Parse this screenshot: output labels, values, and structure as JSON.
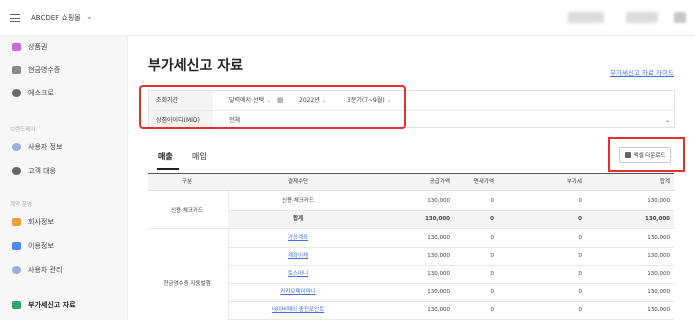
{
  "topbar": {
    "shop_name": "ABCDEF 쇼핑몰"
  },
  "sidebar": {
    "items": [
      {
        "label": "상품권",
        "icon": "gift-card-icon",
        "color": "#c96bd8"
      },
      {
        "label": "현금영수증",
        "icon": "receipt-icon",
        "color": "#8a8a8a"
      },
      {
        "label": "에스크로",
        "icon": "escrow-icon",
        "color": "#6a6a6a"
      },
      {
        "label": "사용자 정보",
        "icon": "user-info-icon",
        "color": "#9ab0d8"
      },
      {
        "label": "고객 대응",
        "icon": "customer-support-icon",
        "color": "#666666"
      },
      {
        "label": "회사정보",
        "icon": "company-icon",
        "color": "#f0a03a"
      },
      {
        "label": "이용정보",
        "icon": "usage-icon",
        "color": "#4a8cf0"
      },
      {
        "label": "사용자 관리",
        "icon": "user-manage-icon",
        "color": "#9ab0d8"
      },
      {
        "label": "부가세신고 자료",
        "icon": "vat-report-icon",
        "color": "#2ea86a"
      }
    ],
    "sections": [
      "브랜드페이",
      "계약·운영"
    ]
  },
  "main": {
    "title": "부가세신고 자료",
    "guide_link": "부가세신고 자료 가이드"
  },
  "filter": {
    "period_label": "조회기간",
    "period_select": "달력에서 선택",
    "year": "2022년",
    "quarter": "3분기(7~9월)",
    "mid_label": "상점아이디(MID)",
    "mid_value": "전체"
  },
  "tabs": [
    {
      "label": "매출",
      "active": true
    },
    {
      "label": "매입",
      "active": false
    }
  ],
  "excel_button": "엑셀 다운로드",
  "table": {
    "headers": [
      "구분",
      "결제수단",
      "공급가액",
      "면세가액",
      "부가세",
      "합계"
    ],
    "group1": "신용·체크카드",
    "group2": "현금영수증 자동발행",
    "rows": [
      {
        "method": "신용·체크카드",
        "supply": "130,000",
        "taxfree": "0",
        "vat": "0",
        "total": "130,000",
        "link": false,
        "bold": false
      },
      {
        "method": "합계",
        "supply": "130,000",
        "taxfree": "0",
        "vat": "0",
        "total": "130,000",
        "link": false,
        "bold": true
      },
      {
        "method": "가상계좌",
        "supply": "130,000",
        "taxfree": "0",
        "vat": "0",
        "total": "130,000",
        "link": true,
        "bold": false
      },
      {
        "method": "계좌이체",
        "supply": "130,000",
        "taxfree": "0",
        "vat": "0",
        "total": "130,000",
        "link": true,
        "bold": false
      },
      {
        "method": "토스머니",
        "supply": "130,000",
        "taxfree": "0",
        "vat": "0",
        "total": "130,000",
        "link": true,
        "bold": false
      },
      {
        "method": "카카오페이머니",
        "supply": "130,000",
        "taxfree": "0",
        "vat": "0",
        "total": "130,000",
        "link": true,
        "bold": false
      },
      {
        "method": "네이버페이 충전포인트",
        "supply": "130,000",
        "taxfree": "0",
        "vat": "0",
        "total": "130,000",
        "link": true,
        "bold": false
      }
    ]
  }
}
